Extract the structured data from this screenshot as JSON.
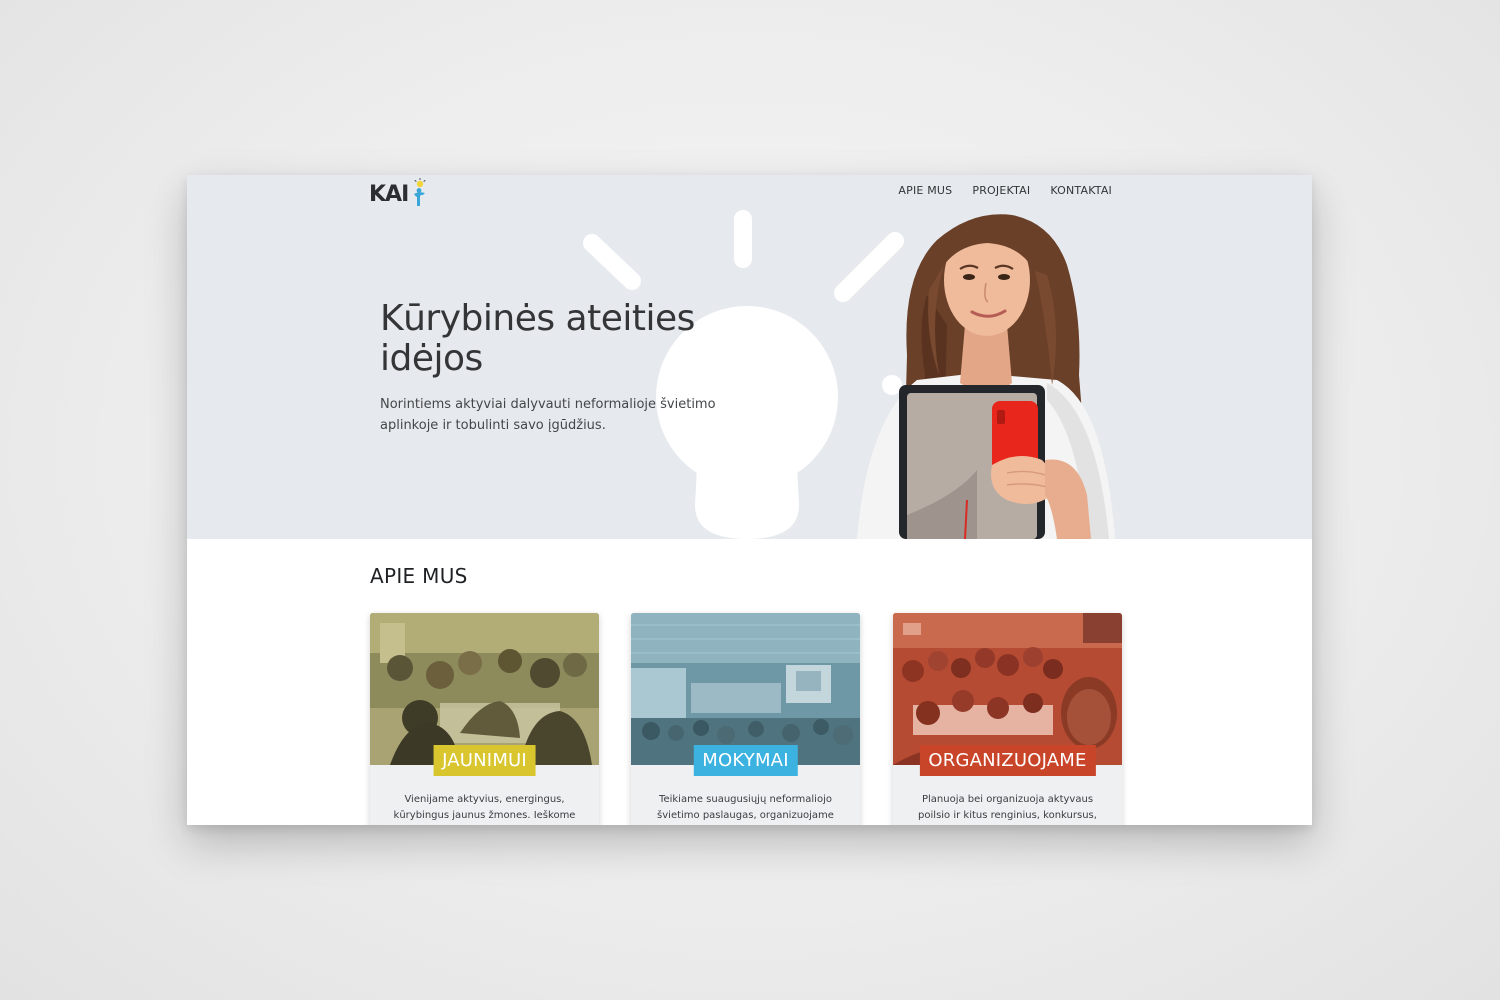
{
  "brand": {
    "name": "KAI",
    "logo_icon": "person-with-lightbulb-icon"
  },
  "nav": {
    "items": [
      {
        "label": "APIE MUS"
      },
      {
        "label": "PROJEKTAI"
      },
      {
        "label": "KONTAKTAI"
      }
    ]
  },
  "hero": {
    "title": "Kūrybinės ateities idėjos",
    "subtitle": "Norintiems aktyviai dalyvauti neformalioje švietimo aplinkoje ir tobulinti savo įgūdžius.",
    "background_color": "#e6eaee"
  },
  "about": {
    "title": "APIE MUS",
    "cards": [
      {
        "label": "JAUNIMUI",
        "text": "Vienijame aktyvius, energingus, kūrybingus jaunus žmones. Ieškome naujų laisvalaikio",
        "accent": "#d9c62f"
      },
      {
        "label": "MOKYMAI",
        "text": "Teikiame suaugusiųjų neformaliojo švietimo paslaugas, organizuojame",
        "accent": "#3cb2e0"
      },
      {
        "label": "ORGANIZUOJAME",
        "text": "Planuoja bei organizuoja aktyvaus poilsio ir kitus renginius, konkursus, rengia švietimo",
        "accent": "#c9452a"
      }
    ]
  }
}
